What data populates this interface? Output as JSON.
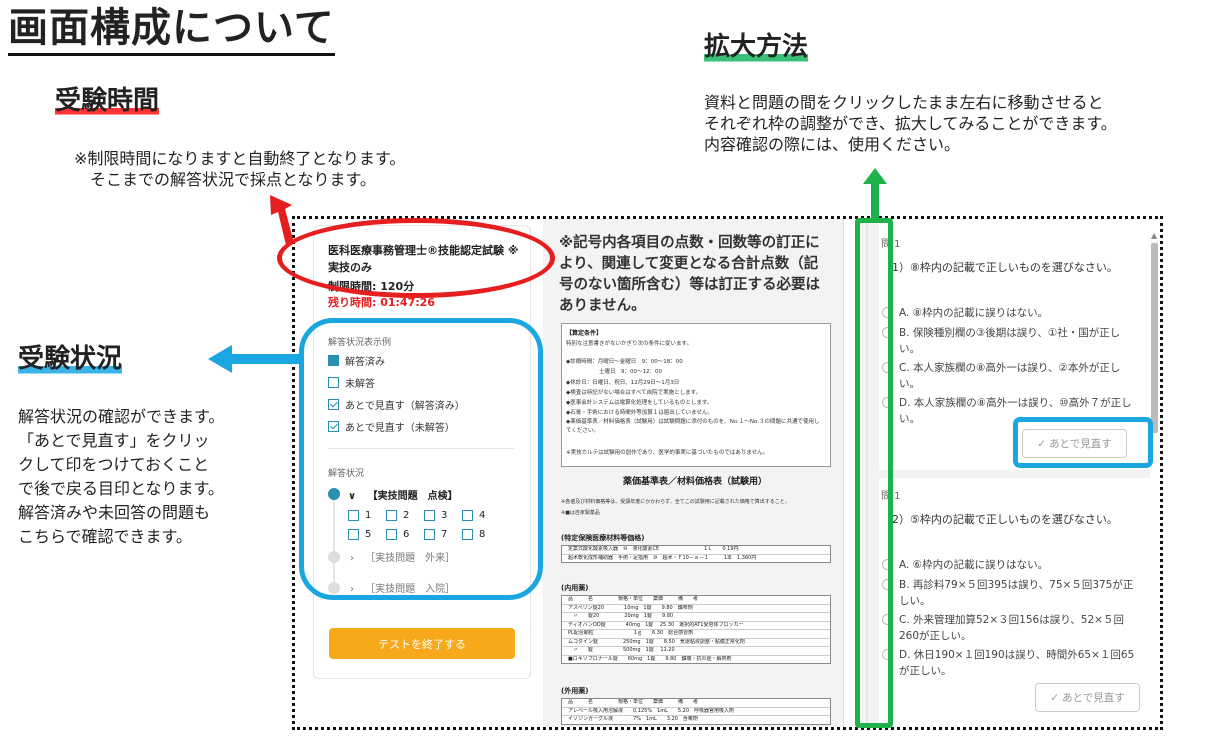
{
  "main_title": "画面構成について",
  "sections": {
    "time": {
      "heading": "受験時間",
      "note": "※制限時間になりますと自動終了となります。\n　そこまでの解答状況で採点となります。"
    },
    "status": {
      "heading": "受験状況",
      "note": "解答状況の確認ができます。\n「あとで見直す」をクリッ\nクして印をつけておくこと\nで後で戻る目印となります。\n解答済みや未回答の問題も\nこちらで確認できます。"
    },
    "zoom": {
      "heading": "拡大方法",
      "note": "資料と問題の間をクリックしたまま左右に移動させると\nそれぞれ枠の調整ができ、拡大してみることができます。\n内容確認の際には、使用ください。"
    }
  },
  "exam": {
    "title": "医科医療事務管理士®技能認定試験 ※実技のみ",
    "limit_time": "制限時間: 120分",
    "remaining_time": "残り時間: 01:47:26",
    "legend_title": "解答状況表示例",
    "legend": [
      {
        "label": "解答済み",
        "style": "filled"
      },
      {
        "label": "未解答",
        "style": "empty"
      },
      {
        "label": "あとで見直す（解答済み）",
        "style": "check"
      },
      {
        "label": "あとで見直す（未解答）",
        "style": "check"
      }
    ],
    "status_title": "解答状況",
    "status_sections": [
      {
        "label": "【実技問題　点検】",
        "chevron": "∨"
      },
      {
        "label": "［実技問題　外来］",
        "chevron": "›"
      },
      {
        "label": "［実技問題　入院］",
        "chevron": "›"
      }
    ],
    "question_numbers": [
      "1",
      "2",
      "3",
      "4",
      "5",
      "6",
      "7",
      "8"
    ],
    "finish_button": "テストを終了する"
  },
  "document": {
    "heading": "※記号内各項目の点数・回数等の訂正により、関連して変更となる合計点数（記号のない箇所含む）等は訂正する必要はありません。",
    "box_title": "【算定条件】",
    "box_lines": [
      "特別な注意書きがないかぎり次の条件に従います。",
      "◆診療時間：月曜日～金曜日　9：00～18：00",
      "　　　　　　土曜日　9：00～12：00",
      "◆休診日：日曜日、祝日、12月29日～1月3日",
      "◆検査は特記がない場合はすべて自院で実施とします。",
      "◆医事会計システムは電算化処理をしているものとします。",
      "◆石膏・手術における時間外等加算１は届出していません。",
      "◆薬価基準表／材料価格表（試験用）は試験問題に添付のものを、No.１～No.３の問題に共通で使用してください。",
      "※実技カルテは試験用の創作であり、医学的事実に基づいたものではありません。"
    ],
    "price_title": "薬価基準表／材料価格表（試験用）",
    "price_note1": "※各値及び材料価格等は、受講年度にかかわらず、全てこの試験用に記載された価格で算出すること。",
    "price_note2": "※■は自家製薬品",
    "sec_material": "(特定保険医療材料等価格)",
    "sec_internal": "(内用薬)",
    "sec_external": "(外用薬)",
    "material_rows": [
      "定案式酸化酸素吸入器　⑩　液化酸素CE　　　　　　　　　1Ｌ　　0.19円",
      "超术軟化成形補助器　手術・足指用　⑩　超术・Ｆ10－ａ－１　　　1本　1,360円"
    ],
    "internal_rows": [
      "品　　　名　　　　　規格・単位　　薬価　　　備　　考",
      "アスペリン錠20　　　　10mg　1錠　　9.80　鎮咳剤",
      "　〃　　錠20　　　　　20mg　1錠　　9.80",
      "ディオバンOD錠　　　　40mg　1錠　 25.30　選択的AT1受容体ブロッカー",
      "PL配合顆粒　　　　　　　　1ｇ　　6.30　総合感冒剤",
      "ムコダイン錠　　　　　250mg　1錠　　8.50　気道粘液調整・粘膜正常化剤",
      "　〃　　錠　　　　　　500mg　1錠　 11.20",
      "■ロキソプロナール錠　　60mg　1錠　　9.80　鎮痛・抗炎症・解熱剤"
    ],
    "external_rows": [
      "品　　　名　　　　　規格・単位　　薬価　　　備　　考",
      "アレベール吸入用溶解液　　0.125%　1mL　　5.20　呼吸器官用吸入剤",
      "イソジンガーグル液　　　　7%　1mL　　3.20　含嗽剤"
    ]
  },
  "questions": [
    {
      "number": "問 1",
      "prompt": "（1）⑧枠内の記載で正しいものを選びなさい。",
      "options": [
        "A. ⑧枠内の記載に誤りはない。",
        "B. 保険種別欄の③後期は誤り、①社・国が正しい。",
        "C. 本人家族欄の⑧高外一は誤り、②本外が正しい。",
        "D. 本人家族欄の⑧高外一は誤り、⑩高外７が正しい。"
      ],
      "later_button": "あとで見直す"
    },
    {
      "number": "問 1",
      "prompt": "（2）⑤枠内の記載で正しいものを選びなさい。",
      "options": [
        "A. ⑥枠内の記載に誤りはない。",
        "B. 再診料79×５回395は誤り、75×５回375が正しい。",
        "C. 外来管理加算52×３回156は誤り、52×５回260が正しい。",
        "D. 休日190×１回190は誤り、時間外65×１回65が正しい。"
      ],
      "later_button": "あとで見直す"
    }
  ],
  "colors": {
    "red_highlight": "#e51f1f",
    "blue_highlight": "#1aa6e0",
    "green_highlight": "#1db34a",
    "finish_button": "#f7a91b",
    "answered": "#2a8fb0"
  }
}
